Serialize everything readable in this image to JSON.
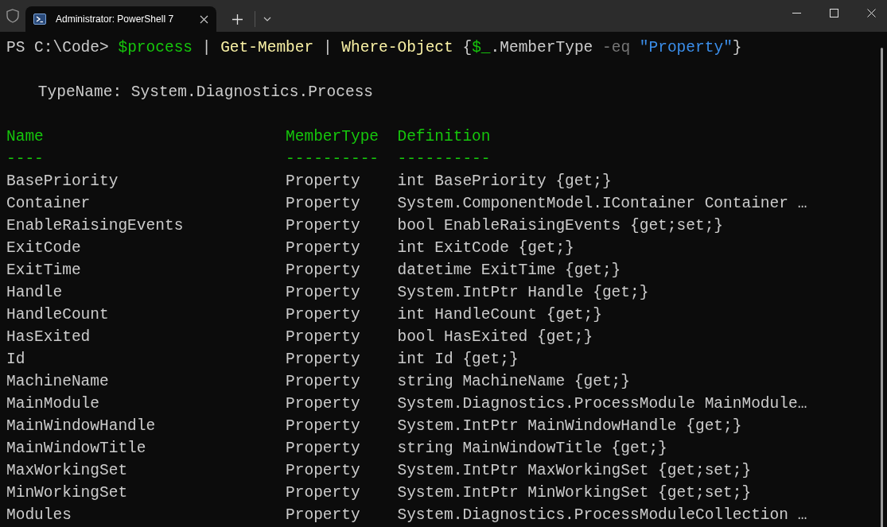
{
  "tab": {
    "title": "Administrator: PowerShell 7",
    "selected": true
  },
  "command": [
    {
      "kind": "prompt",
      "text": "PS C:\\Code> "
    },
    {
      "kind": "variable",
      "text": "$process"
    },
    {
      "kind": "plain",
      "text": " | "
    },
    {
      "kind": "command",
      "text": "Get-Member"
    },
    {
      "kind": "plain",
      "text": " | "
    },
    {
      "kind": "command",
      "text": "Where-Object"
    },
    {
      "kind": "plain",
      "text": " {"
    },
    {
      "kind": "variable",
      "text": "$_"
    },
    {
      "kind": "plain",
      "text": ".MemberType "
    },
    {
      "kind": "operator",
      "text": "-eq "
    },
    {
      "kind": "string",
      "text": "\"Property\""
    },
    {
      "kind": "plain",
      "text": "}"
    }
  ],
  "type_name": "TypeName: System.Diagnostics.Process",
  "table": {
    "columns": [
      "Name",
      "MemberType",
      "Definition"
    ],
    "rules": [
      "----",
      "----------",
      "----------"
    ],
    "rows": [
      [
        "BasePriority",
        "Property",
        "int BasePriority {get;}"
      ],
      [
        "Container",
        "Property",
        "System.ComponentModel.IContainer Container …"
      ],
      [
        "EnableRaisingEvents",
        "Property",
        "bool EnableRaisingEvents {get;set;}"
      ],
      [
        "ExitCode",
        "Property",
        "int ExitCode {get;}"
      ],
      [
        "ExitTime",
        "Property",
        "datetime ExitTime {get;}"
      ],
      [
        "Handle",
        "Property",
        "System.IntPtr Handle {get;}"
      ],
      [
        "HandleCount",
        "Property",
        "int HandleCount {get;}"
      ],
      [
        "HasExited",
        "Property",
        "bool HasExited {get;}"
      ],
      [
        "Id",
        "Property",
        "int Id {get;}"
      ],
      [
        "MachineName",
        "Property",
        "string MachineName {get;}"
      ],
      [
        "MainModule",
        "Property",
        "System.Diagnostics.ProcessModule MainModule…"
      ],
      [
        "MainWindowHandle",
        "Property",
        "System.IntPtr MainWindowHandle {get;}"
      ],
      [
        "MainWindowTitle",
        "Property",
        "string MainWindowTitle {get;}"
      ],
      [
        "MaxWorkingSet",
        "Property",
        "System.IntPtr MaxWorkingSet {get;set;}"
      ],
      [
        "MinWorkingSet",
        "Property",
        "System.IntPtr MinWorkingSet {get;set;}"
      ],
      [
        "Modules",
        "Property",
        "System.Diagnostics.ProcessModuleCollection …"
      ]
    ]
  }
}
